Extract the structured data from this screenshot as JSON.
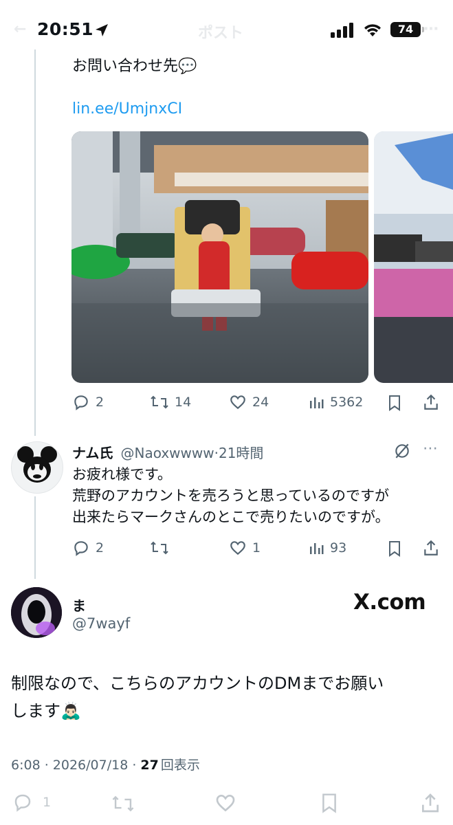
{
  "status_bar": {
    "time": "20:51",
    "battery": "74",
    "ghost_title": "ポスト"
  },
  "tweet1": {
    "text": "お問い合わせ先💬",
    "link": "lin.ee/UmjnxCI",
    "stats": {
      "replies": "2",
      "retweets": "14",
      "likes": "24",
      "views": "5362"
    }
  },
  "reply": {
    "name": "ナム氏",
    "handle": "@Naoxwwww",
    "time": "21時間",
    "lines": [
      "お疲れ様です。",
      "荒野のアカウントを売ろうと思っているのですが",
      "出来たらマークさんのとこで売りたいのですが。"
    ],
    "stats": {
      "replies": "2",
      "likes": "1",
      "views": "93"
    }
  },
  "main_post": {
    "name": "ま",
    "handle": "@7wayf",
    "watermark": "X.com",
    "lines": [
      "制限なので、こちらのアカウントのDMまでお願い",
      "します🙇🏻‍♂️"
    ],
    "footer_time": "6:08 · 2026/07/18 · ",
    "footer_views_count": "27",
    "footer_views_label": "回表示",
    "stats": {
      "replies": "1"
    }
  },
  "colors": {
    "link": "#1d9bf0",
    "text": "#0f1419",
    "muted": "#536471",
    "thread": "#cfd9de"
  }
}
